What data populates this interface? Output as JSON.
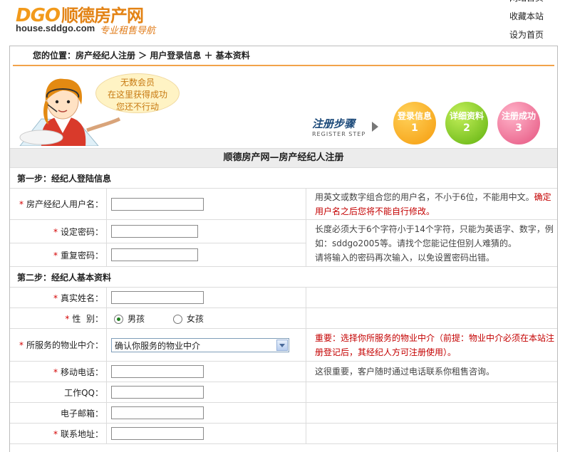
{
  "header": {
    "brand_latin": "DGO",
    "brand_cn": "顺德房产网",
    "domain": "house.sddgo.com",
    "slogan": "专业租售导航",
    "links": [
      "网站首页",
      "收藏本站",
      "设为首页"
    ]
  },
  "breadcrumb": "您的位置：房产经纪人注册 ＞ 用户登录信息 ＋ 基本资料",
  "banner": {
    "bubble": [
      "无数会员",
      "在这里获得成功",
      "您还不行动"
    ],
    "steps_title": "注册步骤",
    "steps_title_en": "REGISTER STEP",
    "steps": [
      {
        "label": "登录信息",
        "num": "1"
      },
      {
        "label": "详细资料",
        "num": "2"
      },
      {
        "label": "注册成功",
        "num": "3"
      }
    ]
  },
  "form": {
    "title": "顺德房产网—房产经纪人注册",
    "step1": "第一步：经纪人登陆信息",
    "username_label": "房产经纪人用户名：",
    "username_tip_a": "用英文或数字组合您的用户名，不小于6位，不能用中文。",
    "username_tip_b": "确定用户名之后您将不能自行修改。",
    "password_label": "设定密码：",
    "password_tip_a": "长度必须大于6个字符小于14个字符，只能为英语字、数字，例如：sddgo2005等。请找个您能记住但别人难猜的。",
    "repeat_label": "重复密码：",
    "repeat_tip": "请将输入的密码再次输入，以免设置密码出错。",
    "step2": "第二步：经纪人基本资料",
    "realname_label": "真实姓名：",
    "gender_label": "性  别：",
    "gender_male": "男孩",
    "gender_female": "女孩",
    "agency_label": "所服务的物业中介：",
    "agency_value": "确认你服务的物业中介",
    "agency_tip": "重要：选择你所服务的物业中介（前提：物业中介必须在本站注册登记后，其经纪人方可注册使用）。",
    "mobile_label": "移动电话：",
    "mobile_tip": "这很重要，客户随时通过电话联系你租售咨询。",
    "qq_label": "工作QQ：",
    "email_label": "电子邮箱：",
    "address_label": "联系地址："
  },
  "colors": {
    "accent": "#f29a1b",
    "required": "#d40000",
    "warning": "#c40000"
  }
}
